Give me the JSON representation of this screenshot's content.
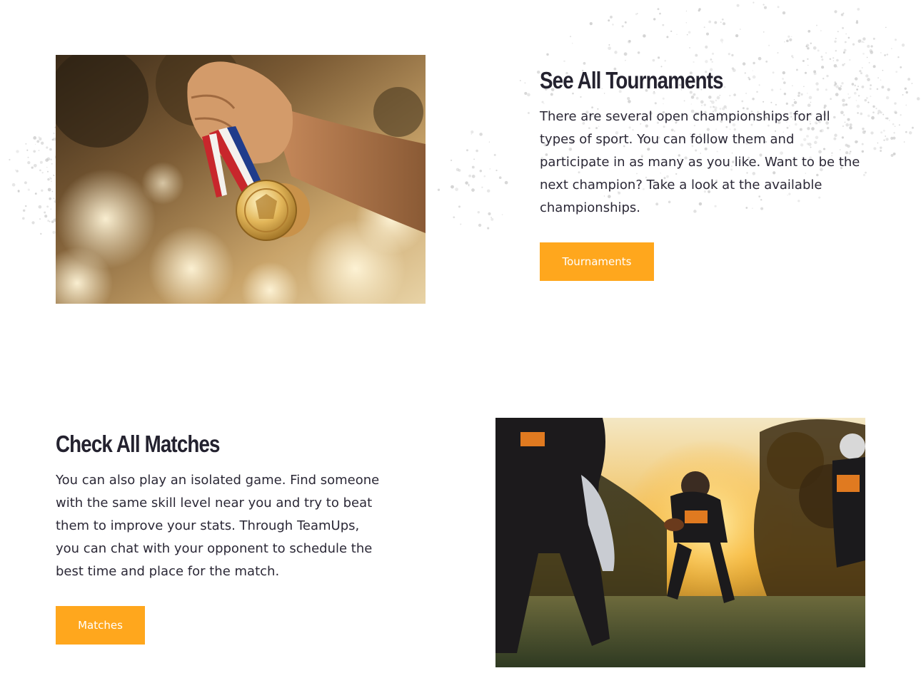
{
  "tournaments_block": {
    "title": "See All Tournaments",
    "description": "There are several open championships for all types of sport. You can follow them and participate in as many as you like. Want to be the next champion? Take a look at the available championships.",
    "button_label": "Tournaments",
    "image": "hand-holding-gold-medals-photo"
  },
  "matches_block": {
    "title": "Check All Matches",
    "description": "You can also play an isolated game. Find someone with the same skill level near you and try to beat them to improve your stats. Through TeamUps, you can chat with your opponent to schedule the best time and place for the match.",
    "button_label": "Matches",
    "image": "american-football-players-sunset-photo"
  },
  "colors": {
    "accent": "#ffa71d",
    "heading": "#24222f",
    "text": "#2b2836",
    "background": "#ffffff",
    "splatter": "#c8c8c8"
  }
}
